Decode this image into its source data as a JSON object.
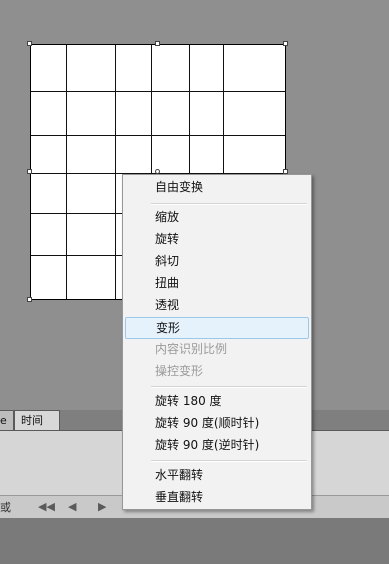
{
  "context_menu": {
    "items": [
      {
        "label": "自由变换",
        "enabled": true
      },
      {
        "label": "缩放",
        "enabled": true
      },
      {
        "label": "旋转",
        "enabled": true
      },
      {
        "label": "斜切",
        "enabled": true
      },
      {
        "label": "扭曲",
        "enabled": true
      },
      {
        "label": "透视",
        "enabled": true
      },
      {
        "label": "变形",
        "enabled": true,
        "highlighted": true
      },
      {
        "label": "内容识别比例",
        "enabled": false
      },
      {
        "label": "操控变形",
        "enabled": false
      },
      {
        "label": "旋转 180 度",
        "enabled": true
      },
      {
        "label": "旋转 90 度(顺时针)",
        "enabled": true
      },
      {
        "label": "旋转 90 度(逆时针)",
        "enabled": true
      },
      {
        "label": "水平翻转",
        "enabled": true
      },
      {
        "label": "垂直翻转",
        "enabled": true
      }
    ]
  },
  "panel": {
    "tab_partial": "e",
    "tab_timeline": "时间轴",
    "toolbar_fragment": "或"
  },
  "colors": {
    "workspace_bg": "#8f8f8f",
    "menu_bg": "#f2f2f2",
    "menu_highlight": "#e5f1fb",
    "menu_highlight_border": "#9cc8ea",
    "disabled_text": "#9a9a9a"
  },
  "icons": {
    "first_frame": "first-frame-icon",
    "prev_frame": "prev-frame-icon",
    "play": "play-icon"
  }
}
